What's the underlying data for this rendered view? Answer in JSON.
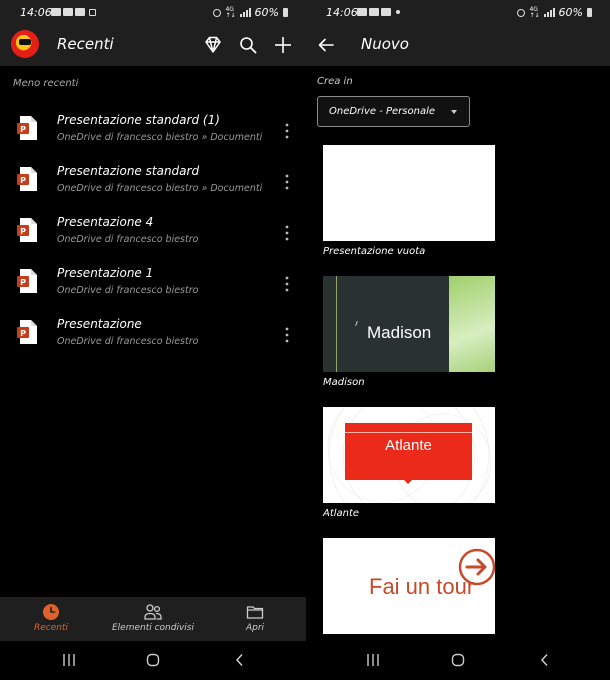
{
  "left": {
    "status": {
      "time": "14:06",
      "battery": "60%"
    },
    "header": {
      "title": "Recenti"
    },
    "section_label": "Meno recenti",
    "files": [
      {
        "name": "Presentazione standard (1)",
        "location": "OneDrive di francesco biestro » Documenti"
      },
      {
        "name": "Presentazione standard",
        "location": "OneDrive di francesco biestro » Documenti"
      },
      {
        "name": "Presentazione 4",
        "location": "OneDrive di francesco biestro"
      },
      {
        "name": "Presentazione 1",
        "location": "OneDrive di francesco biestro"
      },
      {
        "name": "Presentazione",
        "location": "OneDrive di francesco biestro"
      }
    ],
    "nav": {
      "recent": "Recenti",
      "shared": "Elementi condivisi",
      "open": "Apri"
    }
  },
  "right": {
    "status": {
      "time": "14:06",
      "battery": "60%"
    },
    "header": {
      "title": "Nuovo"
    },
    "create_label": "Crea in",
    "location_value": "OneDrive - Personale",
    "templates": [
      {
        "label": "Presentazione vuota"
      },
      {
        "label": "Madison",
        "thumb_text": "Madison"
      },
      {
        "label": "Atlante",
        "thumb_text": "Atlante"
      }
    ],
    "tour_text": "Fai un tour"
  },
  "colors": {
    "accent": "#e0622b",
    "bar": "#1f1f1f",
    "ppt_red": "#c43e1c",
    "atlante_red": "#ec2a1a"
  },
  "icons": {
    "left_header": [
      "logo",
      "diamond-icon",
      "search-icon",
      "plus-icon"
    ],
    "right_header": [
      "back-arrow-icon"
    ]
  }
}
